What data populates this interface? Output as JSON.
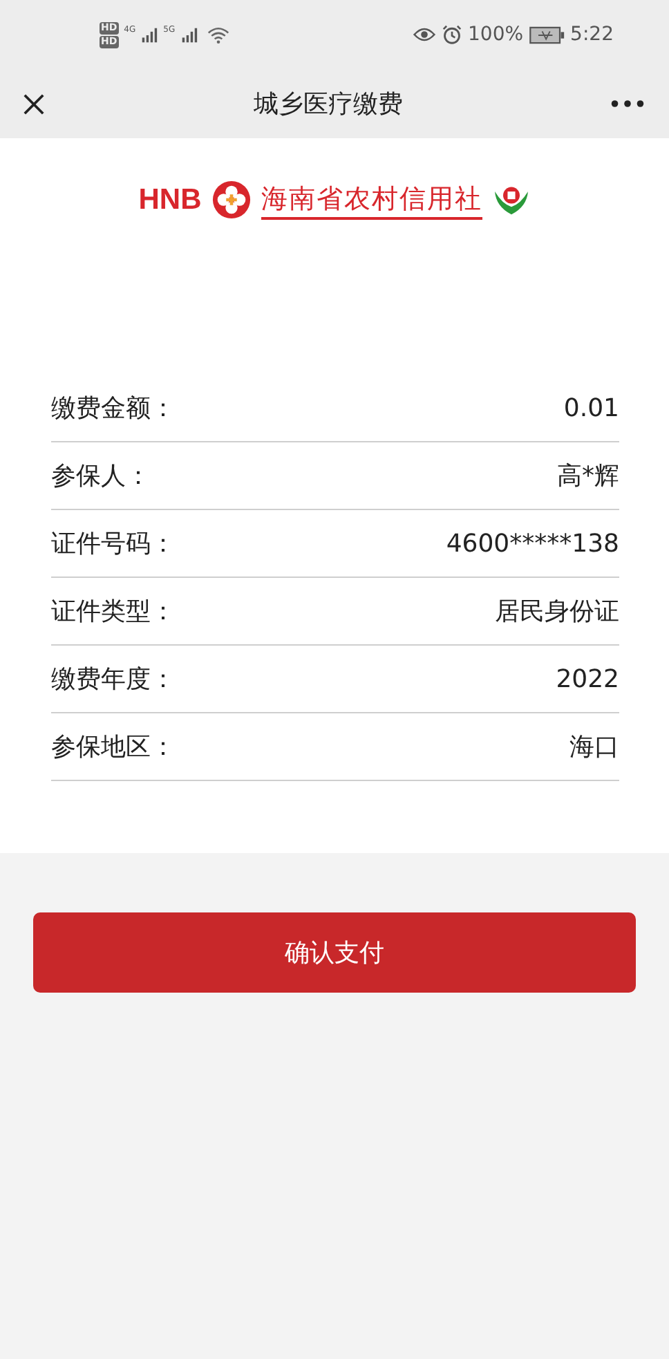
{
  "status_bar": {
    "sim_labels": [
      "HD",
      "HD"
    ],
    "networks": [
      "4G",
      "5G"
    ],
    "battery": "100%",
    "time": "5:22"
  },
  "nav": {
    "title": "城乡医疗缴费"
  },
  "logo": {
    "abbr": "HNB",
    "name": "海南省农村信用社"
  },
  "fields": [
    {
      "label": "缴费金额：",
      "value": "0.01"
    },
    {
      "label": "参保人：",
      "value": "高*辉"
    },
    {
      "label": "证件号码：",
      "value": "4600*****138"
    },
    {
      "label": "证件类型：",
      "value": "居民身份证"
    },
    {
      "label": "缴费年度：",
      "value": "2022"
    },
    {
      "label": "参保地区：",
      "value": "海口"
    }
  ],
  "confirm_button": "确认支付"
}
